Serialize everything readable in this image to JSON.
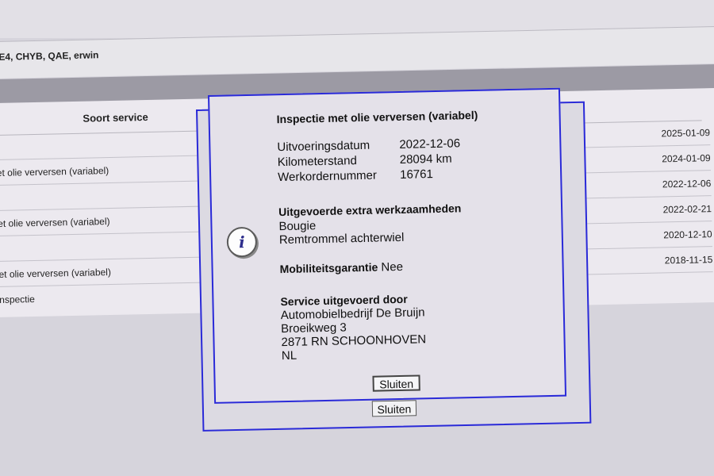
{
  "header": {
    "users": "E4, CHYB, QAE, erwin"
  },
  "table": {
    "col_service": "Soort service",
    "rows": [
      {
        "type": "",
        "date": "2025-01-09"
      },
      {
        "type": "et olie verversen (variabel)",
        "date": "2024-01-09"
      },
      {
        "type": "",
        "date": "2022-12-06"
      },
      {
        "type": "et olie verversen (variabel)",
        "date": "2022-02-21"
      },
      {
        "type": "",
        "date": "2020-12-10"
      },
      {
        "type": "et olie verversen (variabel)",
        "date": "2018-11-15"
      },
      {
        "type": "nspectie",
        "date": ""
      }
    ]
  },
  "dialog": {
    "title": "Inspectie met olie verversen (variabel)",
    "fields": [
      {
        "label": "Uitvoeringsdatum",
        "value": "2022-12-06"
      },
      {
        "label": "Kilometerstand",
        "value": "28094 km"
      },
      {
        "label": "Werkordernummer",
        "value": "16761"
      }
    ],
    "extra_title": "Uitgevoerde extra werkzaamheden",
    "extra_items": [
      "Bougie",
      "Remtrommel achterwiel"
    ],
    "mobility_label": "Mobiliteitsgarantie",
    "mobility_value": "Nee",
    "service_title": "Service uitgevoerd door",
    "service_lines": [
      "Automobielbedrijf De Bruijn",
      "Broeikweg 3",
      "2871 RN SCHOONHOVEN",
      "NL"
    ],
    "close_label": "Sluiten",
    "back_close_label": "Sluiten",
    "icon": "info-icon",
    "accent_color": "#2a2ad8"
  }
}
